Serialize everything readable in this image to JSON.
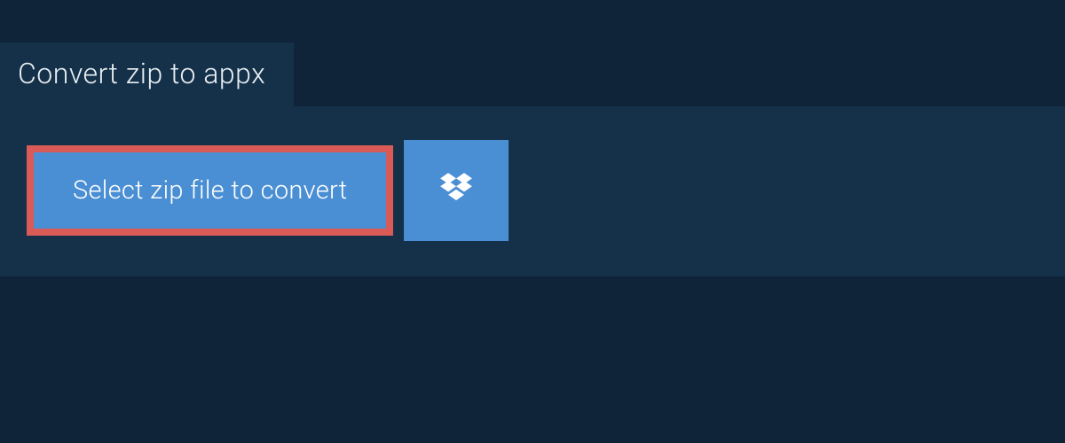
{
  "tab": {
    "label": "Convert zip to appx"
  },
  "main": {
    "select_button_label": "Select zip file to convert"
  },
  "colors": {
    "background": "#0f2438",
    "panel": "#153149",
    "accent": "#4a8fd4",
    "highlight_border": "#d95a56",
    "text_light": "#e8eef3",
    "text_white": "#ffffff"
  }
}
